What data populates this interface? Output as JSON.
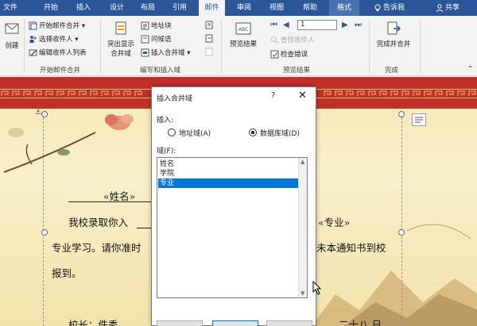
{
  "tabs": [
    "文件",
    "开始",
    "插入",
    "设计",
    "布局",
    "引用",
    "邮件",
    "审阅",
    "视图",
    "帮助",
    "格式"
  ],
  "active_tab": "邮件",
  "tell_me": "告诉我",
  "share": "共享",
  "ribbon": {
    "create": "创建",
    "start_merge": "开始邮件合并",
    "select_recipients": "选择收件人",
    "edit_recipients": "编辑收件人列表",
    "group_start": "开始邮件合并",
    "highlight_fields_1": "突出显示",
    "highlight_fields_2": "合并域",
    "address_block": "地址块",
    "greeting_line": "问候语",
    "insert_merge_field": "插入合并域",
    "group_write": "编写和插入域",
    "preview_results": "预览结果",
    "record_number": "1",
    "find_recipient": "查找收件人",
    "check_errors": "检查错误",
    "group_preview": "预览结果",
    "finish_merge": "完成并合并",
    "group_finish": "完成"
  },
  "document": {
    "field_name": "«姓名»",
    "line1_prefix": "我校录取你入",
    "field_major": "«专业»",
    "line2_prefix": "专业学习。请你准时",
    "line2_suffix": "未本通知书到校",
    "line3": "报到。",
    "footer_left": "校长：佚秀",
    "footer_right": "二十八 日"
  },
  "dialog": {
    "title": "插入合并域",
    "help": "?",
    "close": "✕",
    "insert_label": "插入:",
    "radio_address": "地址域(A)",
    "radio_database": "数据库域(D)",
    "fields_label": "域(F):",
    "fields": [
      "姓名",
      "学院",
      "专业"
    ],
    "selected_field": "专业"
  }
}
